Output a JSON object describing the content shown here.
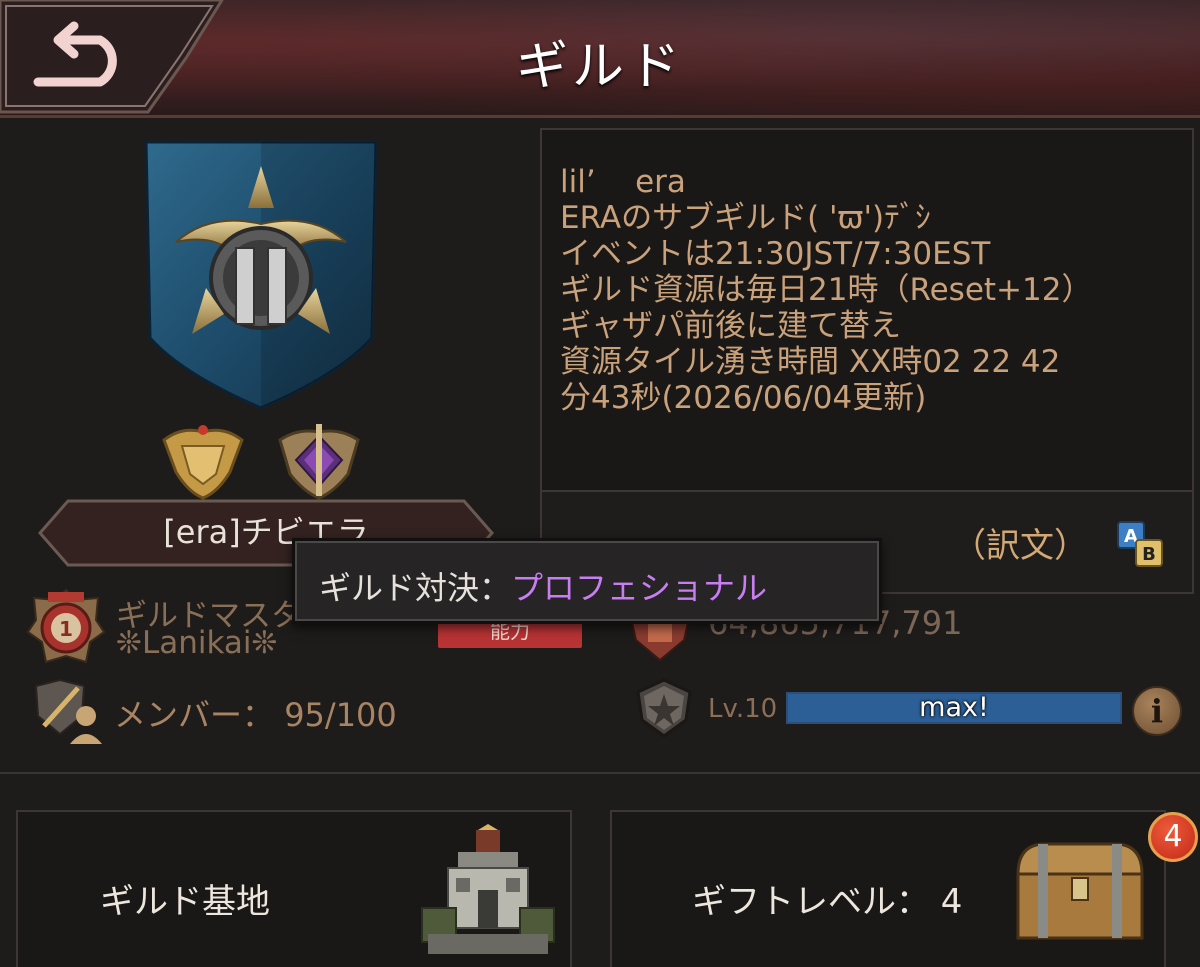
{
  "header": {
    "title": "ギルド",
    "back_icon": "back-arrow-icon"
  },
  "guild": {
    "name": "[era]チビエラ",
    "emblem_icon": "guild-emblem-icon",
    "medals": [
      "gold-medal-icon",
      "purple-medal-icon"
    ]
  },
  "description": {
    "lines": [
      "lil’    era",
      "ERAのサブギルド( 'ϖ')ﾃﾞｼ",
      "イベントは21:30JST/7:30EST",
      "",
      "ギルド資源は毎日21時（Reset+12）",
      "ギャザパ前後に建て替え",
      "資源タイル湧き時間 XX時02 22 42",
      "分43秒(2026/06/04更新)"
    ],
    "translate_label": "（訳文）",
    "translate_icon": "translate-icon"
  },
  "master": {
    "label": "ギルドマスター",
    "name": "❊Lanikai❊",
    "status": "能力"
  },
  "power": {
    "value": "64,865,717,791"
  },
  "members": {
    "label": "メンバー：",
    "value": "95/100"
  },
  "level": {
    "label": "Lv.10",
    "bar_text": "max!",
    "progress": 1.0
  },
  "tooltip": {
    "label": "ギルド対決：",
    "value": "プロフェショナル"
  },
  "buttons": {
    "base": {
      "label": "ギルド基地"
    },
    "gift": {
      "label": "ギフトレベル： 4",
      "badge": "4"
    }
  },
  "colors": {
    "accent_text": "#c9a17a",
    "tooltip_value": "#c87ef2",
    "level_bar": "#2c5f95",
    "badge": "#d93a22"
  }
}
